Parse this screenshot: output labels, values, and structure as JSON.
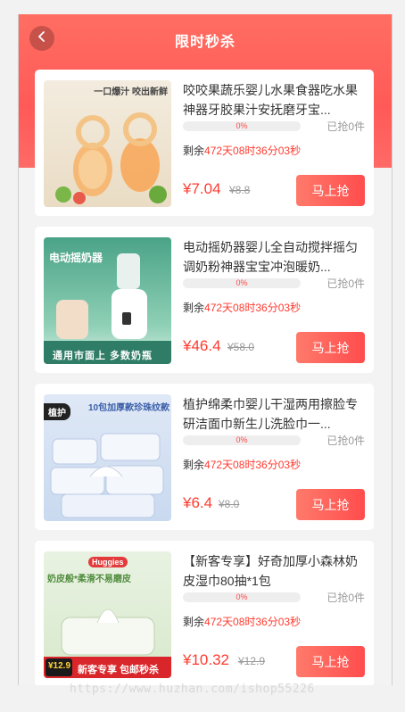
{
  "header": {
    "title": "限时秒杀",
    "back_icon": "chevron-left-icon"
  },
  "colors": {
    "accent": "#ff5a57",
    "price": "#ff3b30",
    "button": "#ff4d4d"
  },
  "products": [
    {
      "name": "咬咬果蔬乐婴儿水果食器吃水果神器牙胶果汁安抚磨牙宝...",
      "progress_label": "0%",
      "progress": 0,
      "sold": "已抢0件",
      "countdown_prefix": "剩余",
      "countdown": "472天08时36分03秒",
      "price": "¥7.04",
      "original_price": "¥8.8",
      "buy_label": "马上抢",
      "image_text": "一口爆汁 咬出新鲜"
    },
    {
      "name": "电动摇奶器婴儿全自动搅拌摇匀调奶粉神器宝宝冲泡暖奶...",
      "progress_label": "0%",
      "progress": 0,
      "sold": "已抢0件",
      "countdown_prefix": "剩余",
      "countdown": "472天08时36分03秒",
      "price": "¥46.4",
      "original_price": "¥58.0",
      "buy_label": "马上抢",
      "image_text": "电动摇奶器",
      "image_footer": "通用市面上 多数奶瓶"
    },
    {
      "name": "植护绵柔巾婴儿干湿两用擦脸专研洁面巾新生儿洗脸巾一...",
      "progress_label": "0%",
      "progress": 0,
      "sold": "已抢0件",
      "countdown_prefix": "剩余",
      "countdown": "472天08时36分03秒",
      "price": "¥6.4",
      "original_price": "¥8.0",
      "buy_label": "马上抢",
      "image_text": "10包加厚款珍珠纹款",
      "image_tag": "植护"
    },
    {
      "name": "【新客专享】好奇加厚小森林奶皮湿巾80抽*1包",
      "progress_label": "0%",
      "progress": 0,
      "sold": "已抢0件",
      "countdown_prefix": "剩余",
      "countdown": "472天08时36分03秒",
      "price": "¥10.32",
      "original_price": "¥12.9",
      "buy_label": "马上抢",
      "image_text": "奶皮般*柔滑不易磨皮",
      "image_footer": "新客专享 包邮秒杀",
      "image_price": "¥12.9"
    }
  ],
  "watermark": "https://www.huzhan.com/ishop55226"
}
